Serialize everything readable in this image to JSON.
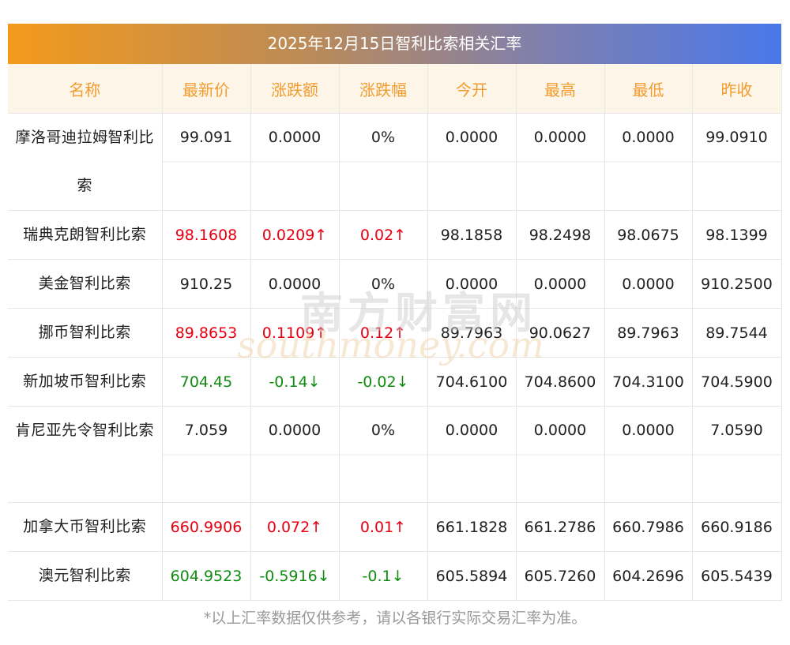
{
  "title": "2025年12月15日智利比索相关汇率",
  "headers": [
    "名称",
    "最新价",
    "涨跌额",
    "涨跌幅",
    "今开",
    "最高",
    "最低",
    "昨收"
  ],
  "rows": [
    {
      "name": "摩洛哥迪拉姆智利比索",
      "latest": "99.091",
      "change": "0.0000",
      "pct": "0%",
      "open": "0.0000",
      "high": "0.0000",
      "low": "0.0000",
      "prev": "99.0910",
      "dir": "flat"
    },
    {
      "name": "瑞典克朗智利比索",
      "latest": "98.1608",
      "change": "0.0209↑",
      "pct": "0.02↑",
      "open": "98.1858",
      "high": "98.2498",
      "low": "98.0675",
      "prev": "98.1399",
      "dir": "up"
    },
    {
      "name": "美金智利比索",
      "latest": "910.25",
      "change": "0.0000",
      "pct": "0%",
      "open": "0.0000",
      "high": "0.0000",
      "low": "0.0000",
      "prev": "910.2500",
      "dir": "flat"
    },
    {
      "name": "挪币智利比索",
      "latest": "89.8653",
      "change": "0.1109↑",
      "pct": "0.12↑",
      "open": "89.7963",
      "high": "90.0627",
      "low": "89.7963",
      "prev": "89.7544",
      "dir": "up"
    },
    {
      "name": "新加坡币智利比索",
      "latest": "704.45",
      "change": "-0.14↓",
      "pct": "-0.02↓",
      "open": "704.6100",
      "high": "704.8600",
      "low": "704.3100",
      "prev": "704.5900",
      "dir": "down"
    },
    {
      "name": "肯尼亚先令智利比索",
      "latest": "7.059",
      "change": "0.0000",
      "pct": "0%",
      "open": "0.0000",
      "high": "0.0000",
      "low": "0.0000",
      "prev": "7.0590",
      "dir": "flat"
    },
    {
      "name": "加拿大币智利比索",
      "latest": "660.9906",
      "change": "0.072↑",
      "pct": "0.01↑",
      "open": "661.1828",
      "high": "661.2786",
      "low": "660.7986",
      "prev": "660.9186",
      "dir": "up"
    },
    {
      "name": "澳元智利比索",
      "latest": "604.9523",
      "change": "-0.5916↓",
      "pct": "-0.1↓",
      "open": "605.5894",
      "high": "605.7260",
      "low": "604.2696",
      "prev": "605.5439",
      "dir": "down"
    }
  ],
  "note": "*以上汇率数据仅供参考，请以各银行实际交易汇率为准。",
  "watermark": {
    "cn": "南方财富网",
    "en": "southmoney.com"
  },
  "colors": {
    "up": "#e60012",
    "down": "#118c11",
    "header_text": "#f29b2e"
  }
}
